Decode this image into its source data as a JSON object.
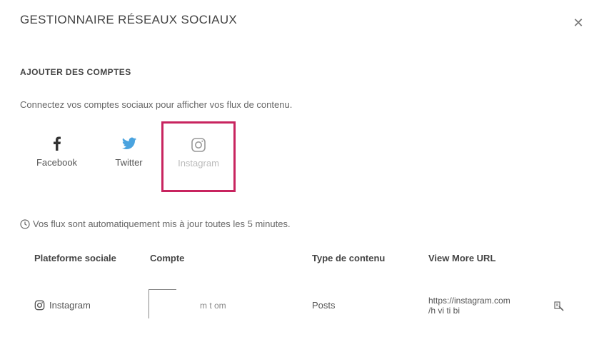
{
  "modal": {
    "title": "GESTIONNAIRE RÉSEAUX SOCIAUX",
    "close_icon": "close-icon"
  },
  "add_accounts": {
    "heading": "AJOUTER DES COMPTES",
    "intro": "Connectez vos comptes sociaux pour afficher vos flux de contenu.",
    "platforms": [
      {
        "label": "Facebook",
        "icon": "facebook-icon"
      },
      {
        "label": "Twitter",
        "icon": "twitter-icon"
      },
      {
        "label": "Instagram",
        "icon": "instagram-icon"
      }
    ]
  },
  "info": {
    "text": "Vos flux sont automatiquement mis à jour toutes les 5 minutes."
  },
  "table": {
    "headers": [
      "Plateforme sociale",
      "Compte",
      "Type de contenu",
      "View More URL"
    ],
    "rows": [
      {
        "platform": "Instagram",
        "account": "m   t   om",
        "content_type": "Posts",
        "url_line1": "https://instagram.com",
        "url_line2": "/h   vi   ti   bi"
      }
    ]
  },
  "colors": {
    "highlight": "#c8245f",
    "twitter": "#4aa3df"
  }
}
